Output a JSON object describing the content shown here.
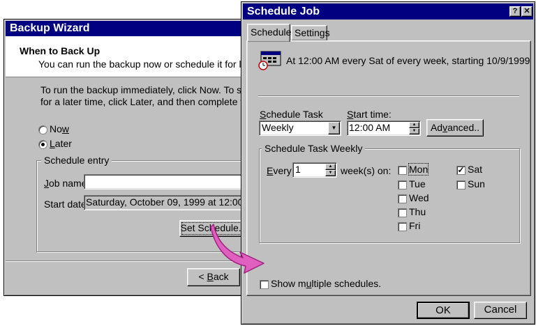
{
  "backup_wizard": {
    "title": "Backup Wizard",
    "header_title": "When to Back Up",
    "header_subtitle": "You can run the backup now or schedule it for later",
    "instructions": "To run the backup immediately, click Now.  To schedule the backup for a later time, click Later, and then complete the Schedule entry.",
    "option_now": "Now",
    "option_later": "Later",
    "selected_option": "Later",
    "schedule_entry_legend": "Schedule entry",
    "job_name_label": "Job name:",
    "job_name_value": "",
    "start_date_label": "Start date",
    "start_date_value": "Saturday, October 09, 1999 at 12:00 AM",
    "set_schedule_button": "Set Schedule...",
    "back_button": "< Back"
  },
  "schedule_job": {
    "title": "Schedule Job",
    "help_button": "?",
    "close_button": "✕",
    "tabs": [
      {
        "label": "Schedule",
        "active": true
      },
      {
        "label": "Settings",
        "active": false
      }
    ],
    "summary": "At 12:00 AM every Sat of every week, starting 10/9/1999",
    "summary_icon": "calendar-clock-icon",
    "schedule_task_label": "Schedule Task",
    "schedule_task_value": "Weekly",
    "start_time_label": "Start time:",
    "start_time_value": "12:00 AM",
    "advanced_button": "Advanced..",
    "weekly_group_legend": "Schedule Task Weekly",
    "every_label": "Every",
    "every_value": "1",
    "weeks_on_label": "week(s) on:",
    "days": [
      {
        "label": "Mon",
        "checked": false
      },
      {
        "label": "Tue",
        "checked": false
      },
      {
        "label": "Wed",
        "checked": false
      },
      {
        "label": "Thu",
        "checked": false
      },
      {
        "label": "Fri",
        "checked": false
      },
      {
        "label": "Sat",
        "checked": true
      },
      {
        "label": "Sun",
        "checked": false
      }
    ],
    "show_multiple_label": "Show multiple schedules.",
    "show_multiple_checked": false,
    "ok_button": "OK",
    "cancel_button": "Cancel"
  },
  "callout_arrow_color": "#e060c0"
}
